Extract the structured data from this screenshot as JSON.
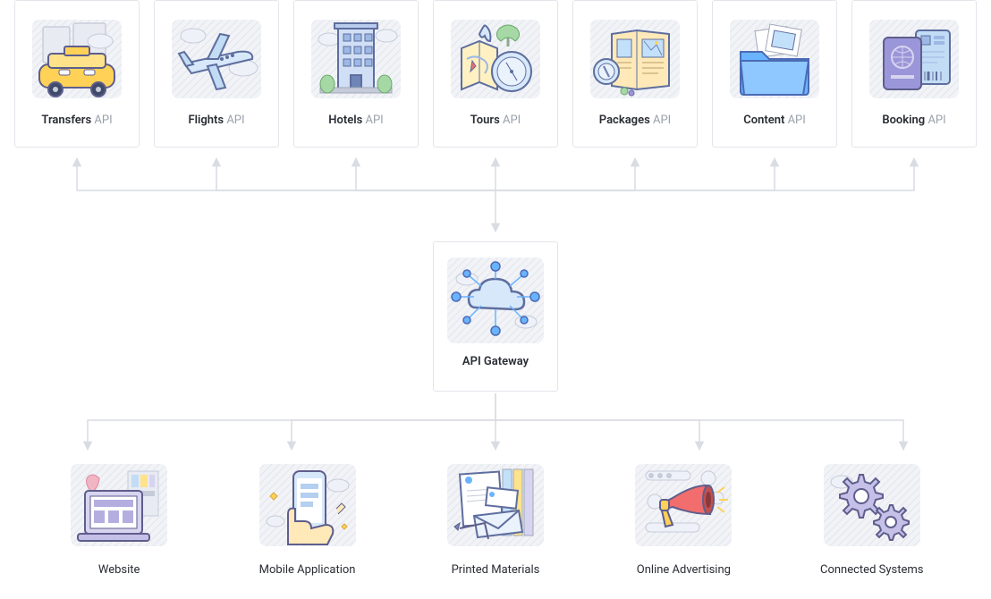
{
  "apis": [
    {
      "name": "Transfers",
      "suffix": "API",
      "icon": "taxi-icon"
    },
    {
      "name": "Flights",
      "suffix": "API",
      "icon": "plane-icon"
    },
    {
      "name": "Hotels",
      "suffix": "API",
      "icon": "hotel-icon"
    },
    {
      "name": "Tours",
      "suffix": "API",
      "icon": "compass-map-icon"
    },
    {
      "name": "Packages",
      "suffix": "API",
      "icon": "catalog-icon"
    },
    {
      "name": "Content",
      "suffix": "API",
      "icon": "folder-files-icon"
    },
    {
      "name": "Booking",
      "suffix": "API",
      "icon": "passport-ticket-icon"
    }
  ],
  "center": {
    "label": "API Gateway",
    "icon": "cloud-nodes-icon"
  },
  "clients": [
    {
      "label": "Website",
      "icon": "laptop-icon"
    },
    {
      "label": "Mobile Application",
      "icon": "phone-hand-icon"
    },
    {
      "label": "Printed Materials",
      "icon": "documents-icon"
    },
    {
      "label": "Online Advertising",
      "icon": "megaphone-icon"
    },
    {
      "label": "Connected Systems",
      "icon": "gears-icon"
    }
  ],
  "colors": {
    "card_border": "#E3E5EA",
    "connector": "#D9DCE3",
    "text_primary": "#292C33",
    "text_muted": "#9AA0AA",
    "accent_blue": "#6AB4FF",
    "accent_yellow": "#FFD257",
    "accent_purple": "#9B96D9",
    "accent_red": "#F26D6D"
  }
}
